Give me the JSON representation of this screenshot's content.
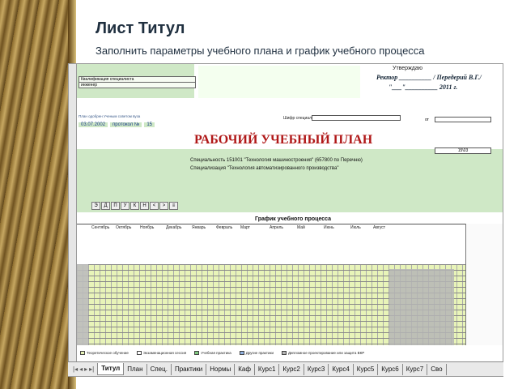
{
  "slide": {
    "title": "Лист Титул",
    "subtitle": "Заполнить параметры учебного плана и график учебного процесса"
  },
  "sheet": {
    "approve_label": "Утверждаю",
    "rector_line": "Ректор __________ / Передерий В.Г./",
    "rector_date": "\"___\"__________ 2011 г.",
    "plan_made_label": "План одобрен Ученым советом вуза",
    "plan_date": "03.07.2002",
    "protocol_label": "протокол №",
    "protocol_no": "15",
    "shifr_label": "Шифр специальности",
    "ot_label": "от",
    "main_title": "РАБОЧИЙ УЧЕБНЫЙ ПЛАН",
    "specialty": "Специальность 151001 \"Технология машиностроения\" (657800 по Перечню)",
    "specialization": "Специализация \"Технология автоматизированного производства\"",
    "small_code": "15\\03",
    "grid_title": "График учебного процесса",
    "months": [
      "Сентябрь",
      "Октябрь",
      "Ноябрь",
      "Декабрь",
      "Январь",
      "Февраль",
      "Март",
      "Апрель",
      "Май",
      "Июнь",
      "Июль",
      "Август"
    ],
    "mini_table": [
      "Квалификация специалиста",
      "инженер"
    ],
    "legend": [
      "Теоретическое обучение",
      "Экзаменационная сессия",
      "Учебная практика",
      "Другие практики",
      "Дипломное проектирование или защита ВКР"
    ],
    "toolbar": [
      "Э",
      "Д",
      "П",
      "У",
      "К",
      "Н",
      "<",
      ">",
      "≡"
    ]
  },
  "tabs": [
    "Титул",
    "План",
    "Спец.",
    "Практики",
    "Нормы",
    "Каф",
    "Курс1",
    "Курс2",
    "Курс3",
    "Курс4",
    "Курс5",
    "Курс6",
    "Курс7",
    "Сво"
  ],
  "active_tab": "Титул"
}
